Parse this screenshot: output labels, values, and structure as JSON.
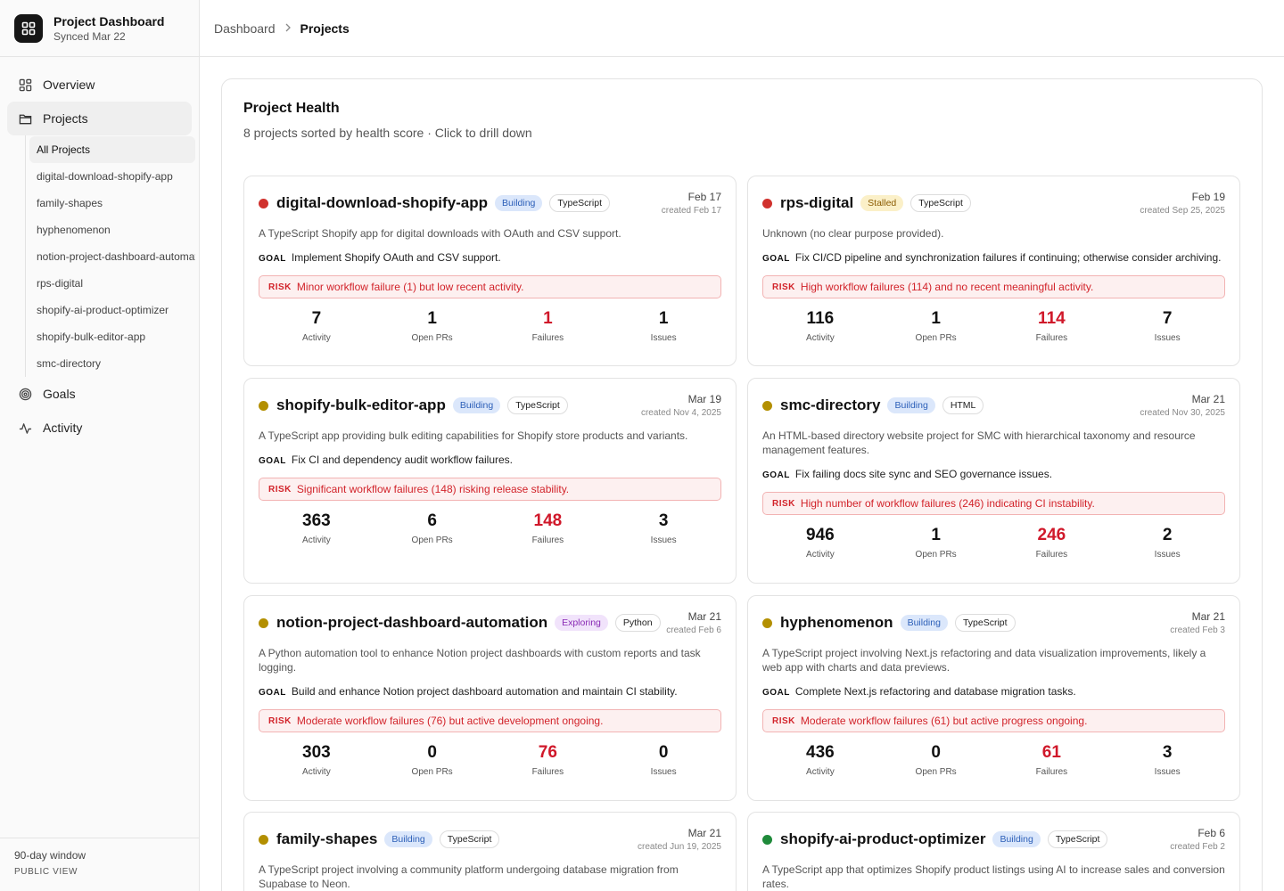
{
  "brand": {
    "title": "Project Dashboard",
    "subtitle": "Synced Mar 22"
  },
  "nav": {
    "overview": "Overview",
    "projects": "Projects",
    "goals": "Goals",
    "activity": "Activity",
    "project_items": [
      "All Projects",
      "digital-download-shopify-app",
      "family-shapes",
      "hyphenomenon",
      "notion-project-dashboard-automation",
      "rps-digital",
      "shopify-ai-product-optimizer",
      "shopify-bulk-editor-app",
      "smc-directory"
    ]
  },
  "footer": {
    "window": "90-day window",
    "view": "PUBLIC VIEW"
  },
  "breadcrumb": {
    "parent": "Dashboard",
    "current": "Projects"
  },
  "panel": {
    "title": "Project Health",
    "subtitle": "8 projects sorted by health score · Click to drill down"
  },
  "labels": {
    "goal": "GOAL",
    "risk": "RISK",
    "activity": "Activity",
    "open_prs": "Open PRs",
    "failures": "Failures",
    "issues": "Issues"
  },
  "colors": {
    "red": "#d0312d",
    "yellow": "#b38f00",
    "green": "#1f8a3a"
  },
  "status_styles": {
    "Building": {
      "bg": "#dbe7fb",
      "fg": "#2c5fb8"
    },
    "Stalled": {
      "bg": "#fbf0c8",
      "fg": "#8a5a00"
    },
    "Exploring": {
      "bg": "#f1e3fb",
      "fg": "#8a2bb5"
    }
  },
  "projects": [
    {
      "name": "digital-download-shopify-app",
      "health": "red",
      "status": "Building",
      "language": "TypeScript",
      "updated": "Feb 17",
      "created": "created Feb 17",
      "description": "A TypeScript Shopify app for digital downloads with OAuth and CSV support.",
      "goal": "Implement Shopify OAuth and CSV support.",
      "risk": "Minor workflow failure (1) but low recent activity.",
      "activity": "7",
      "open_prs": "1",
      "failures": "1",
      "issues": "1"
    },
    {
      "name": "rps-digital",
      "health": "red",
      "status": "Stalled",
      "language": "TypeScript",
      "updated": "Feb 19",
      "created": "created Sep 25, 2025",
      "description": "Unknown (no clear purpose provided).",
      "goal": "Fix CI/CD pipeline and synchronization failures if continuing; otherwise consider archiving.",
      "risk": "High workflow failures (114) and no recent meaningful activity.",
      "activity": "116",
      "open_prs": "1",
      "failures": "114",
      "issues": "7"
    },
    {
      "name": "shopify-bulk-editor-app",
      "health": "yellow",
      "status": "Building",
      "language": "TypeScript",
      "updated": "Mar 19",
      "created": "created Nov 4, 2025",
      "description": "A TypeScript app providing bulk editing capabilities for Shopify store products and variants.",
      "goal": "Fix CI and dependency audit workflow failures.",
      "risk": "Significant workflow failures (148) risking release stability.",
      "activity": "363",
      "open_prs": "6",
      "failures": "148",
      "issues": "3"
    },
    {
      "name": "smc-directory",
      "health": "yellow",
      "status": "Building",
      "language": "HTML",
      "updated": "Mar 21",
      "created": "created Nov 30, 2025",
      "description": "An HTML-based directory website project for SMC with hierarchical taxonomy and resource management features.",
      "goal": "Fix failing docs site sync and SEO governance issues.",
      "risk": "High number of workflow failures (246) indicating CI instability.",
      "activity": "946",
      "open_prs": "1",
      "failures": "246",
      "issues": "2"
    },
    {
      "name": "notion-project-dashboard-automation",
      "health": "yellow",
      "status": "Exploring",
      "language": "Python",
      "updated": "Mar 21",
      "created": "created Feb 6",
      "description": "A Python automation tool to enhance Notion project dashboards with custom reports and task logging.",
      "goal": "Build and enhance Notion project dashboard automation and maintain CI stability.",
      "risk": "Moderate workflow failures (76) but active development ongoing.",
      "activity": "303",
      "open_prs": "0",
      "failures": "76",
      "issues": "0"
    },
    {
      "name": "hyphenomenon",
      "health": "yellow",
      "status": "Building",
      "language": "TypeScript",
      "updated": "Mar 21",
      "created": "created Feb 3",
      "description": "A TypeScript project involving Next.js refactoring and data visualization improvements, likely a web app with charts and data previews.",
      "goal": "Complete Next.js refactoring and database migration tasks.",
      "risk": "Moderate workflow failures (61) but active progress ongoing.",
      "activity": "436",
      "open_prs": "0",
      "failures": "61",
      "issues": "3"
    },
    {
      "name": "family-shapes",
      "health": "yellow",
      "status": "Building",
      "language": "TypeScript",
      "updated": "Mar 21",
      "created": "created Jun 19, 2025",
      "description": "A TypeScript project involving a community platform undergoing database migration from Supabase to Neon.",
      "goal": "",
      "risk": "",
      "activity": "",
      "open_prs": "",
      "failures": "",
      "issues": ""
    },
    {
      "name": "shopify-ai-product-optimizer",
      "health": "green",
      "status": "Building",
      "language": "TypeScript",
      "updated": "Feb 6",
      "created": "created Feb 2",
      "description": "A TypeScript app that optimizes Shopify product listings using AI to increase sales and conversion rates.",
      "goal": "",
      "risk": "",
      "activity": "",
      "open_prs": "",
      "failures": "",
      "issues": ""
    }
  ]
}
